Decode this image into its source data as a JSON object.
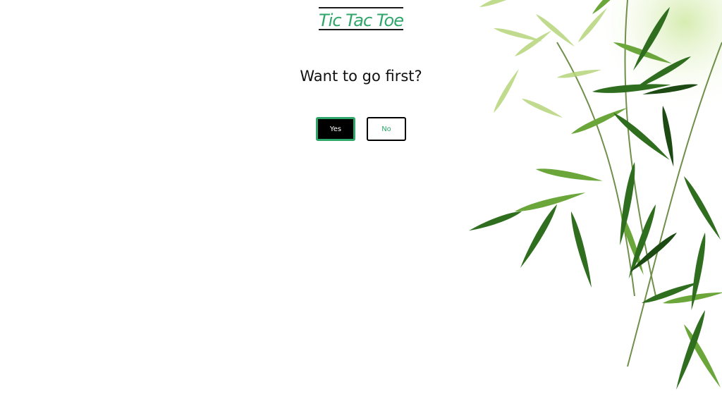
{
  "game": {
    "title": "Tic Tac Toe",
    "prompt": "Want to go first?",
    "yes_label": "Yes",
    "no_label": "No"
  },
  "colors": {
    "accent": "#2fa66a",
    "text": "#111111",
    "yes_bg": "#000000",
    "background": "#ffffff"
  },
  "decoration": {
    "icon": "bamboo-leaves-image"
  }
}
